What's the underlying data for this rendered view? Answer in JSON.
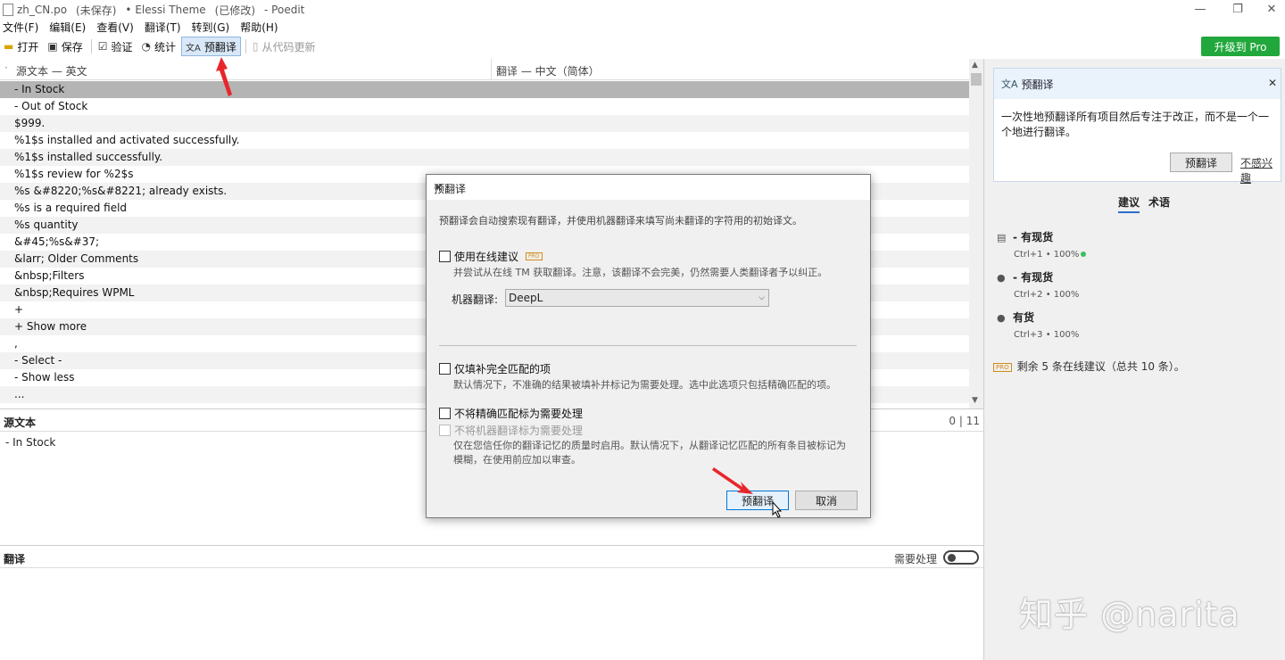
{
  "window": {
    "title_file": "zh_CN.po",
    "title_unsaved": "(未保存)",
    "title_project": "• Elessi Theme",
    "title_modified": "(已修改)",
    "title_app": "- Poedit"
  },
  "menu": [
    "文件(F)",
    "编辑(E)",
    "查看(V)",
    "翻译(T)",
    "转到(G)",
    "帮助(H)"
  ],
  "toolbar": {
    "open": "打开",
    "save": "保存",
    "validate": "验证",
    "stats": "统计",
    "pretranslate": "预翻译",
    "update_from_code": "从代码更新",
    "pro": "升级到 Pro"
  },
  "list": {
    "col_source": "源文本 — 英文",
    "col_translation": "翻译 — 中文（简体）",
    "rows": [
      "- In Stock",
      "- Out of Stock",
      "$999.",
      "%1$s installed and activated successfully.",
      "%1$s installed successfully.",
      "%1$s review for %2$s",
      "%s &#8220;%s&#8221; already exists.",
      "%s is a required field",
      "%s quantity",
      "&#45;%s&#37;",
      "&larr; Older Comments",
      "&nbsp;Filters",
      "&nbsp;Requires WPML",
      "+",
      "+ Show more",
      ",",
      "- Select -",
      "- Show less",
      "..."
    ]
  },
  "source_panel": {
    "label": "源文本",
    "count": "0 | 11",
    "text": "- In Stock"
  },
  "translation_panel": {
    "label": "翻译",
    "needs_work": "需要处理"
  },
  "sidebar": {
    "card_title": "预翻译",
    "card_body": "一次性地预翻译所有项目然后专注于改正，而不是一个一个地进行翻译。",
    "card_button": "预翻译",
    "card_link": "不感兴趣",
    "tab_suggestions": "建议",
    "tab_terms": "术语",
    "suggestions": [
      {
        "text": "- 有现货",
        "meta": "Ctrl+1 • 100%"
      },
      {
        "text": "- 有现货",
        "meta": "Ctrl+2 • 100%"
      },
      {
        "text": "有货",
        "meta": "Ctrl+3 • 100%"
      }
    ],
    "pro_badge": "PRO",
    "remaining": "剩余 5 条在线建议（总共 10 条）。"
  },
  "dialog": {
    "title": "预翻译",
    "description": "预翻译会自动搜索现有翻译，并使用机器翻译来填写尚未翻译的字符用的初始译文。",
    "online_suggestions": "使用在线建议",
    "pro_badge": "PRO",
    "online_note": "并尝试从在线 TM 获取翻译。注意，该翻译不会完美，仍然需要人类翻译者予以纠正。",
    "mt_label": "机器翻译:",
    "mt_value": "DeepL",
    "exact_only": "仅填补完全匹配的项",
    "exact_note": "默认情况下，不准确的结果被填补并标记为需要处理。选中此选项只包括精确匹配的项。",
    "no_fuzzy": "不将精确匹配标为需要处理",
    "no_fuzzy_mt": "不将机器翻译标为需要处理",
    "no_fuzzy_note": "仅在您信任你的翻译记忆的质量时启用。默认情况下，从翻译记忆匹配的所有条目被标记为模糊，在使用前应加以审查。",
    "ok": "预翻译",
    "cancel": "取消"
  },
  "watermark": "知乎 @narita",
  "colors": {
    "pro_green": "#21a83c",
    "selection": "#b4b4b4",
    "arrow_red": "#e8262a"
  }
}
